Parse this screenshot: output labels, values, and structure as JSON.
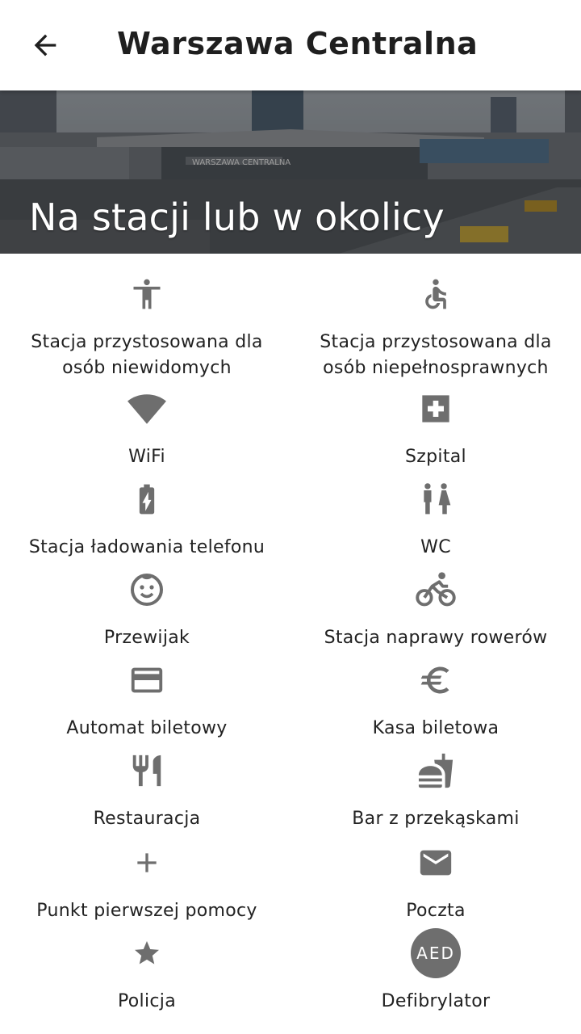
{
  "header": {
    "title": "Warszawa Centralna",
    "back_icon": "arrow-back-icon"
  },
  "hero": {
    "title": "Na stacji lub w okolicy",
    "image_text": "WARSZAWA CENTRALNA"
  },
  "amenities": [
    {
      "label_lines": [
        "Stacja przystosowana dla",
        "osób niewidomych"
      ],
      "icon": "accessibility-icon"
    },
    {
      "label_lines": [
        "Stacja przystosowana dla",
        "osób niepełnosprawnych"
      ],
      "icon": "wheelchair-icon"
    },
    {
      "label_lines": [
        "WiFi"
      ],
      "icon": "wifi-icon"
    },
    {
      "label_lines": [
        "Szpital"
      ],
      "icon": "hospital-icon"
    },
    {
      "label_lines": [
        "Stacja ładowania telefonu"
      ],
      "icon": "battery-charging-icon"
    },
    {
      "label_lines": [
        "WC"
      ],
      "icon": "wc-icon"
    },
    {
      "label_lines": [
        "Przewijak"
      ],
      "icon": "baby-face-icon"
    },
    {
      "label_lines": [
        "Stacja naprawy rowerów"
      ],
      "icon": "bike-icon"
    },
    {
      "label_lines": [
        "Automat biletowy"
      ],
      "icon": "credit-card-icon"
    },
    {
      "label_lines": [
        "Kasa biletowa"
      ],
      "icon": "euro-icon"
    },
    {
      "label_lines": [
        "Restauracja"
      ],
      "icon": "restaurant-icon"
    },
    {
      "label_lines": [
        "Bar z przekąskami"
      ],
      "icon": "fastfood-icon"
    },
    {
      "label_lines": [
        "Punkt pierwszej pomocy"
      ],
      "icon": "plus-icon"
    },
    {
      "label_lines": [
        "Poczta"
      ],
      "icon": "mail-icon"
    },
    {
      "label_lines": [
        "Policja"
      ],
      "icon": "star-icon"
    },
    {
      "label_lines": [
        "Defibrylator"
      ],
      "icon": "aed-icon",
      "badge": "AED"
    }
  ],
  "colors": {
    "icon": "#6e6e6e",
    "text": "#222222",
    "appbar": "#ffffff"
  }
}
